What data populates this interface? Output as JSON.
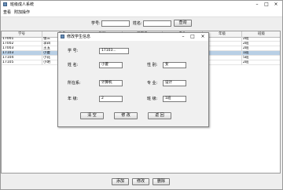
{
  "window": {
    "title": "班级成人系统"
  },
  "menu": {
    "items": [
      "查看",
      "附加操作"
    ]
  },
  "search": {
    "student_id_label": "学号:",
    "student_id_value": "",
    "name_label": "姓名:",
    "name_value": "",
    "query_button": "查询"
  },
  "table": {
    "columns": [
      "学号",
      "姓名",
      "性别",
      "所在系",
      "专业",
      "年级",
      "班级"
    ],
    "rows": [
      [
        "17001",
        "张三",
        "",
        "",
        "",
        "",
        "2班"
      ],
      [
        "17002",
        "李四",
        "",
        "",
        "",
        "",
        "2班"
      ],
      [
        "17003",
        "王五",
        "",
        "",
        "",
        "",
        "2班"
      ],
      [
        "17103",
        "小菱",
        "",
        "",
        "",
        "",
        "1班"
      ],
      [
        "17104",
        "小花",
        "",
        "",
        "",
        "",
        "5班"
      ],
      [
        "17105",
        "小明",
        "",
        "",
        "",
        "",
        "2班"
      ]
    ],
    "selected_row": 3
  },
  "bottom": {
    "add_button": "添加",
    "edit_button": "修改",
    "delete_button": "删除"
  },
  "dialog": {
    "title": "修改学生信息",
    "fields": {
      "student_id": {
        "label": "学 号:",
        "value": "17103..."
      },
      "name": {
        "label": "姓 名:",
        "value": "小菱"
      },
      "gender": {
        "label": "性 别:",
        "value": "女"
      },
      "department": {
        "label": "所在系:",
        "value": "计算机"
      },
      "major": {
        "label": "专 业:",
        "value": "设计"
      },
      "grade": {
        "label": "年 级:",
        "value": "2"
      },
      "class": {
        "label": "班 级:",
        "value": "1班"
      }
    },
    "buttons": {
      "clear": "清 空",
      "edit": "修 改",
      "back": "返 回"
    }
  },
  "icons": {
    "minimize": "minimize-icon",
    "maximize": "maximize-icon",
    "close": "close-icon",
    "app": "app-icon"
  }
}
